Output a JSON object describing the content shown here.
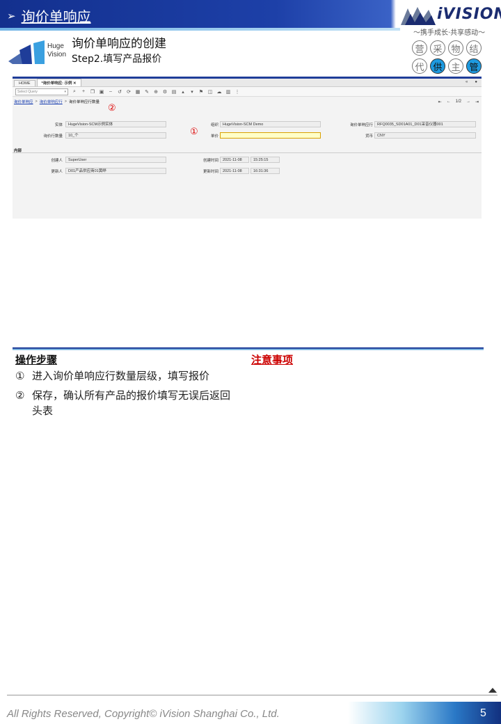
{
  "header": {
    "title": "询价单响应",
    "brand": "iVISION",
    "slogan": "～携手成长·共享感动～"
  },
  "logo": {
    "line1": "Huge",
    "line2": "Vision"
  },
  "subtitle": {
    "line1": "询价单响应的创建",
    "line2": "Step2.填写产品报价"
  },
  "chars": [
    "营",
    "采",
    "物",
    "结",
    "代",
    "供",
    "主",
    "管"
  ],
  "app": {
    "tabs": [
      "HOME",
      "*询价单响应: 示例"
    ],
    "search_placeholder": "Select Query",
    "breadcrumb": [
      "询价单响应",
      "询价单响应行",
      "询价单响应行数量"
    ],
    "pager": "1/2",
    "fields": {
      "entity_label": "实体",
      "entity_value": "HugeVision-SCM示例实体",
      "org_label": "组织",
      "org_value": "HugeVision-SCM Demo",
      "line_label": "询价单响应行",
      "line_value": "RFQ0035_SD01A01_D01采音仪器001",
      "qty_label": "询价行数量",
      "qty_value": "10_个",
      "price_label": "单价",
      "price_value": "",
      "currency_label": "货币",
      "currency_value": "CNY",
      "section": "内部",
      "creator_label": "创建人",
      "creator_value": "SuperUser",
      "ctime_label": "创建时间",
      "cdate": "2021-11-08",
      "ctime": "15:25:15",
      "updater_label": "更新人",
      "updater_value": "D01产品供应商01黄晔",
      "utime_label": "更新时间",
      "udate": "2021-11-08",
      "utime": "16:31:36"
    },
    "callout1": "①",
    "callout2": "②"
  },
  "steps": {
    "heading": "操作步骤",
    "notes_heading": "注意事项",
    "items": [
      {
        "num": "①",
        "text": "进入询价单响应行数量层级，填写报价"
      },
      {
        "num": "②",
        "text": "保存，确认所有产品的报价填写无误后返回头表"
      }
    ]
  },
  "footer": {
    "copyright": "All Rights Reserved, Copyright© iVision Shanghai Co., Ltd.",
    "page": "5"
  }
}
